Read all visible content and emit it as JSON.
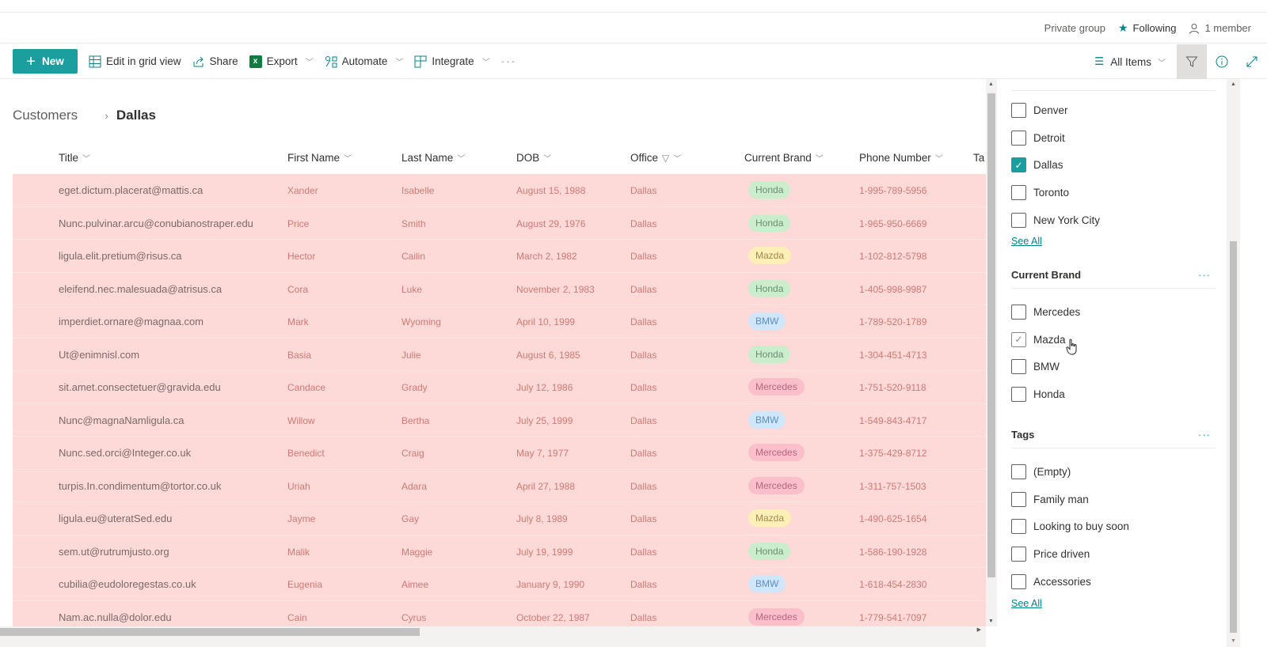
{
  "groupbar": {
    "privacy": "Private group",
    "following": "Following",
    "members": "1 member"
  },
  "commandbar": {
    "new_label": "New",
    "edit_grid_label": "Edit in grid view",
    "share_label": "Share",
    "export_label": "Export",
    "automate_label": "Automate",
    "integrate_label": "Integrate",
    "more_label": "···",
    "view_label": "All Items"
  },
  "breadcrumb": {
    "parent": "Customers",
    "current": "Dallas"
  },
  "columns": [
    "Title",
    "First Name",
    "Last Name",
    "DOB",
    "Office",
    "Current Brand",
    "Phone Number",
    "Ta"
  ],
  "rows": [
    {
      "title": "eget.dictum.placerat@mattis.ca",
      "first": "Xander",
      "last": "Isabelle",
      "dob": "August 15, 1988",
      "office": "Dallas",
      "brand": "Honda",
      "phone": "1-995-789-5956"
    },
    {
      "title": "Nunc.pulvinar.arcu@conubianostraper.edu",
      "first": "Price",
      "last": "Smith",
      "dob": "August 29, 1976",
      "office": "Dallas",
      "brand": "Honda",
      "phone": "1-965-950-6669"
    },
    {
      "title": "ligula.elit.pretium@risus.ca",
      "first": "Hector",
      "last": "Cailin",
      "dob": "March 2, 1982",
      "office": "Dallas",
      "brand": "Mazda",
      "phone": "1-102-812-5798"
    },
    {
      "title": "eleifend.nec.malesuada@atrisus.ca",
      "first": "Cora",
      "last": "Luke",
      "dob": "November 2, 1983",
      "office": "Dallas",
      "brand": "Honda",
      "phone": "1-405-998-9987"
    },
    {
      "title": "imperdiet.ornare@magnaa.com",
      "first": "Mark",
      "last": "Wyoming",
      "dob": "April 10, 1999",
      "office": "Dallas",
      "brand": "BMW",
      "phone": "1-789-520-1789"
    },
    {
      "title": "Ut@enimnisl.com",
      "first": "Basia",
      "last": "Julie",
      "dob": "August 6, 1985",
      "office": "Dallas",
      "brand": "Honda",
      "phone": "1-304-451-4713"
    },
    {
      "title": "sit.amet.consectetuer@gravida.edu",
      "first": "Candace",
      "last": "Grady",
      "dob": "July 12, 1986",
      "office": "Dallas",
      "brand": "Mercedes",
      "phone": "1-751-520-9118"
    },
    {
      "title": "Nunc@magnaNamligula.ca",
      "first": "Willow",
      "last": "Bertha",
      "dob": "July 25, 1999",
      "office": "Dallas",
      "brand": "BMW",
      "phone": "1-549-843-4717"
    },
    {
      "title": "Nunc.sed.orci@Integer.co.uk",
      "first": "Benedict",
      "last": "Craig",
      "dob": "May 7, 1977",
      "office": "Dallas",
      "brand": "Mercedes",
      "phone": "1-375-429-8712"
    },
    {
      "title": "turpis.In.condimentum@tortor.co.uk",
      "first": "Uriah",
      "last": "Adara",
      "dob": "April 27, 1988",
      "office": "Dallas",
      "brand": "Mercedes",
      "phone": "1-311-757-1503"
    },
    {
      "title": "ligula.eu@uteratSed.edu",
      "first": "Jayme",
      "last": "Gay",
      "dob": "July 8, 1989",
      "office": "Dallas",
      "brand": "Mazda",
      "phone": "1-490-625-1654"
    },
    {
      "title": "sem.ut@rutrumjusto.org",
      "first": "Malik",
      "last": "Maggie",
      "dob": "July 19, 1999",
      "office": "Dallas",
      "brand": "Honda",
      "phone": "1-586-190-1928"
    },
    {
      "title": "cubilia@eudoloregestas.co.uk",
      "first": "Eugenia",
      "last": "Aimee",
      "dob": "January 9, 1990",
      "office": "Dallas",
      "brand": "BMW",
      "phone": "1-618-454-2830"
    },
    {
      "title": "Nam.ac.nulla@dolor.edu",
      "first": "Cain",
      "last": "Cyrus",
      "dob": "October 22, 1987",
      "office": "Dallas",
      "brand": "Mercedes",
      "phone": "1-779-541-7097"
    }
  ],
  "filter_pane": {
    "office_options": [
      {
        "label": "Denver",
        "checked": false
      },
      {
        "label": "Detroit",
        "checked": false
      },
      {
        "label": "Dallas",
        "checked": true
      },
      {
        "label": "Toronto",
        "checked": false
      },
      {
        "label": "New York City",
        "checked": false
      }
    ],
    "see_all": "See All",
    "brand_title": "Current Brand",
    "brand_options": [
      {
        "label": "Mercedes",
        "checked": false
      },
      {
        "label": "Mazda",
        "checked": false,
        "hover": true
      },
      {
        "label": "BMW",
        "checked": false
      },
      {
        "label": "Honda",
        "checked": false
      }
    ],
    "tags_title": "Tags",
    "tags_options": [
      {
        "label": "(Empty)",
        "checked": false
      },
      {
        "label": "Family man",
        "checked": false
      },
      {
        "label": "Looking to buy soon",
        "checked": false
      },
      {
        "label": "Price driven",
        "checked": false
      },
      {
        "label": "Accessories",
        "checked": false
      }
    ],
    "more_label": "···"
  },
  "colors": {
    "accent": "#1a9e9e",
    "row_highlight": "#fdd9d7",
    "honda": "#caedcc",
    "mazda": "#fdefb6",
    "bmw": "#cfe6fb",
    "mercedes": "#fbbfcc"
  }
}
